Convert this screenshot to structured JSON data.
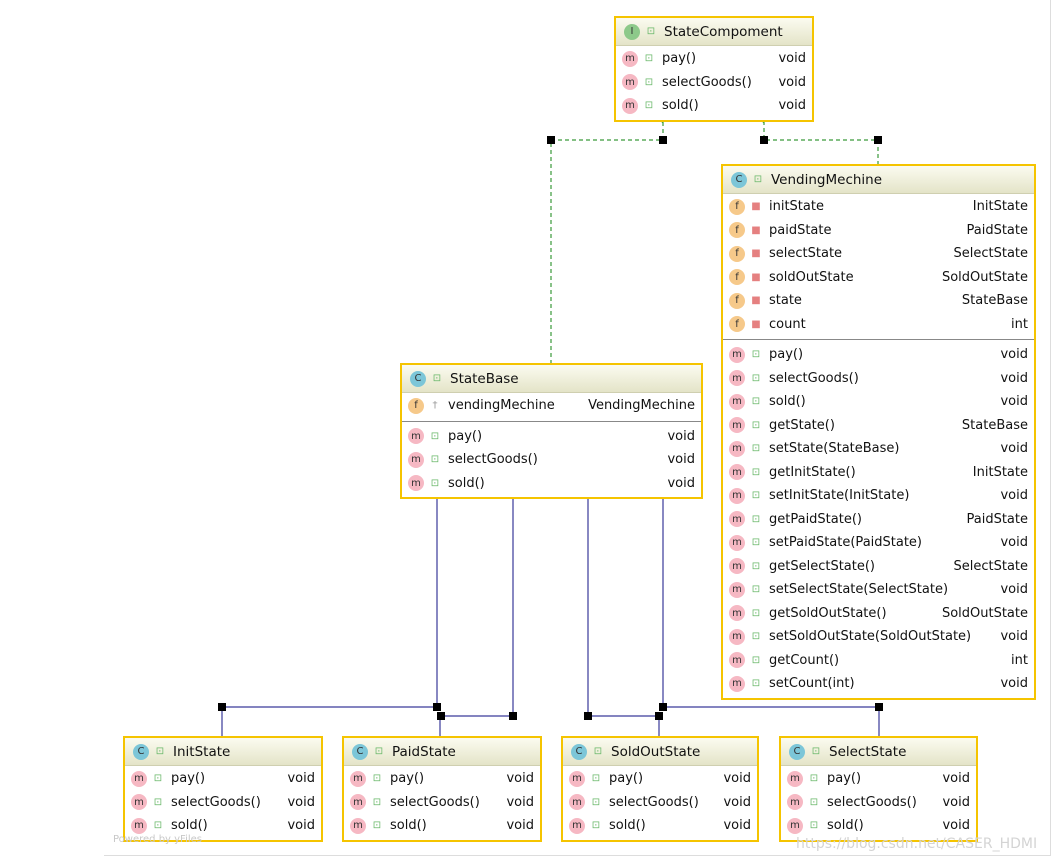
{
  "classes": [
    {
      "id": "StateCompoment",
      "kind": "I",
      "name": "StateCompoment",
      "fields": [],
      "methods": [
        {
          "name": "pay()",
          "type": "void"
        },
        {
          "name": "selectGoods()",
          "type": "void"
        },
        {
          "name": "sold()",
          "type": "void"
        }
      ]
    },
    {
      "id": "VendingMechine",
      "kind": "C",
      "name": "VendingMechine",
      "fields": [
        {
          "name": "initState",
          "type": "InitState",
          "visibility": "private"
        },
        {
          "name": "paidState",
          "type": "PaidState",
          "visibility": "private"
        },
        {
          "name": "selectState",
          "type": "SelectState",
          "visibility": "private"
        },
        {
          "name": "soldOutState",
          "type": "SoldOutState",
          "visibility": "private"
        },
        {
          "name": "state",
          "type": "StateBase",
          "visibility": "private"
        },
        {
          "name": "count",
          "type": "int",
          "visibility": "private"
        }
      ],
      "methods": [
        {
          "name": "pay()",
          "type": "void"
        },
        {
          "name": "selectGoods()",
          "type": "void"
        },
        {
          "name": "sold()",
          "type": "void"
        },
        {
          "name": "getState()",
          "type": "StateBase"
        },
        {
          "name": "setState(StateBase)",
          "type": "void"
        },
        {
          "name": "getInitState()",
          "type": "InitState"
        },
        {
          "name": "setInitState(InitState)",
          "type": "void"
        },
        {
          "name": "getPaidState()",
          "type": "PaidState"
        },
        {
          "name": "setPaidState(PaidState)",
          "type": "void"
        },
        {
          "name": "getSelectState()",
          "type": "SelectState"
        },
        {
          "name": "setSelectState(SelectState)",
          "type": "void"
        },
        {
          "name": "getSoldOutState()",
          "type": "SoldOutState"
        },
        {
          "name": "setSoldOutState(SoldOutState)",
          "type": "void"
        },
        {
          "name": "getCount()",
          "type": "int"
        },
        {
          "name": "setCount(int)",
          "type": "void"
        }
      ]
    },
    {
      "id": "StateBase",
      "kind": "C",
      "name": "StateBase",
      "fields": [
        {
          "name": "vendingMechine",
          "type": "VendingMechine",
          "visibility": "package"
        }
      ],
      "methods": [
        {
          "name": "pay()",
          "type": "void"
        },
        {
          "name": "selectGoods()",
          "type": "void"
        },
        {
          "name": "sold()",
          "type": "void"
        }
      ]
    },
    {
      "id": "InitState",
      "kind": "C",
      "name": "InitState",
      "fields": [],
      "methods": [
        {
          "name": "pay()",
          "type": "void"
        },
        {
          "name": "selectGoods()",
          "type": "void"
        },
        {
          "name": "sold()",
          "type": "void"
        }
      ]
    },
    {
      "id": "PaidState",
      "kind": "C",
      "name": "PaidState",
      "fields": [],
      "methods": [
        {
          "name": "pay()",
          "type": "void"
        },
        {
          "name": "selectGoods()",
          "type": "void"
        },
        {
          "name": "sold()",
          "type": "void"
        }
      ]
    },
    {
      "id": "SoldOutState",
      "kind": "C",
      "name": "SoldOutState",
      "fields": [],
      "methods": [
        {
          "name": "pay()",
          "type": "void"
        },
        {
          "name": "selectGoods()",
          "type": "void"
        },
        {
          "name": "sold()",
          "type": "void"
        }
      ]
    },
    {
      "id": "SelectState",
      "kind": "C",
      "name": "SelectState",
      "fields": [],
      "methods": [
        {
          "name": "pay()",
          "type": "void"
        },
        {
          "name": "selectGoods()",
          "type": "void"
        },
        {
          "name": "sold()",
          "type": "void"
        }
      ]
    }
  ],
  "relations": [
    {
      "from": "StateBase",
      "to": "StateCompoment",
      "type": "implements"
    },
    {
      "from": "VendingMechine",
      "to": "StateCompoment",
      "type": "implements"
    },
    {
      "from": "InitState",
      "to": "StateBase",
      "type": "extends"
    },
    {
      "from": "PaidState",
      "to": "StateBase",
      "type": "extends"
    },
    {
      "from": "SoldOutState",
      "to": "StateBase",
      "type": "extends"
    },
    {
      "from": "SelectState",
      "to": "StateBase",
      "type": "extends"
    }
  ],
  "colors": {
    "implements": "#3a9a3a",
    "extends": "#1a1a8c",
    "border": "#f5c400"
  },
  "watermark_powered": "Powered by yFiles",
  "watermark_url": "https://blog.csdn.net/CASER_HDMI"
}
